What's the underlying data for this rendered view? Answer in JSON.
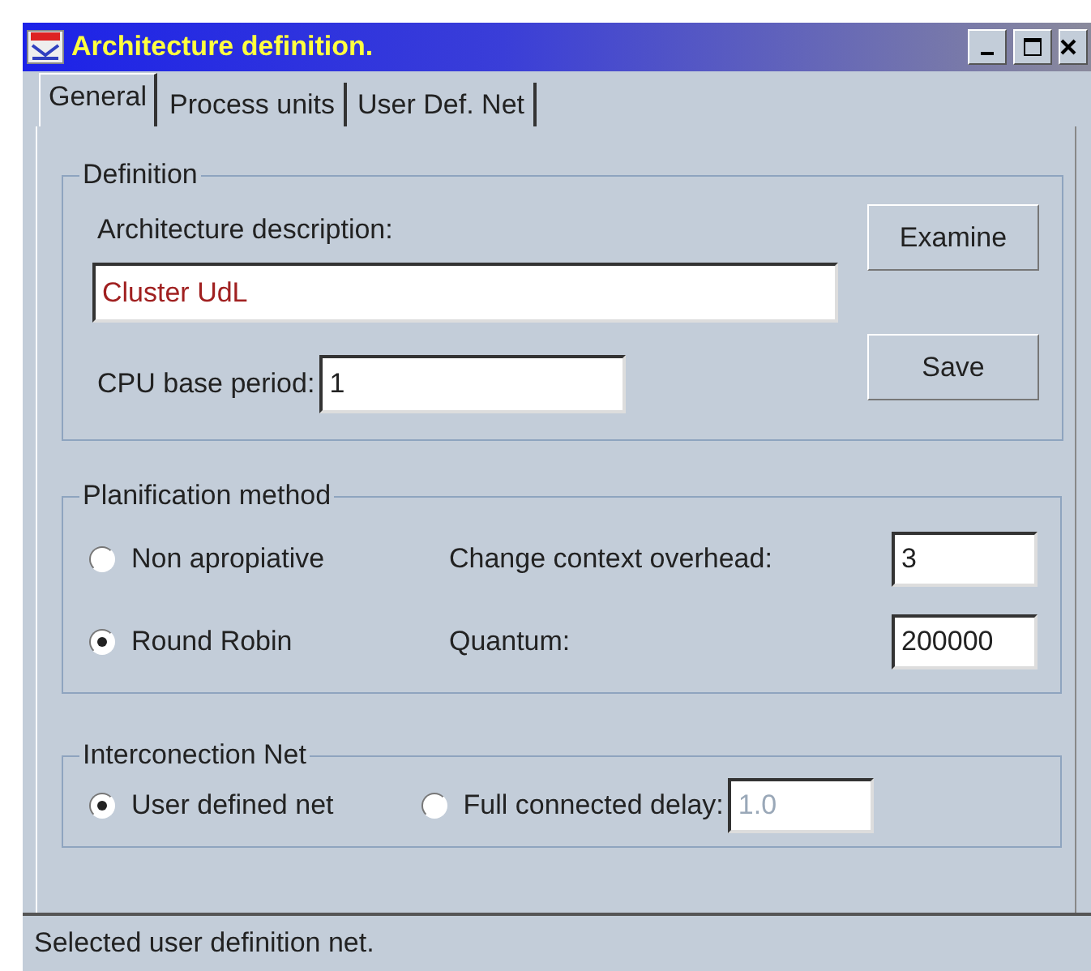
{
  "window": {
    "title": "Architecture definition."
  },
  "tabs": [
    {
      "label": "General",
      "selected": true
    },
    {
      "label": "Process units",
      "selected": false
    },
    {
      "label": "User Def. Net",
      "selected": false
    }
  ],
  "definition": {
    "title": "Definition",
    "description_label": "Architecture description:",
    "description_value": "Cluster UdL",
    "cpu_label": "CPU base period:",
    "cpu_value": "1",
    "buttons": [
      "Examine",
      "Save"
    ]
  },
  "planification": {
    "title": "Planification method",
    "options": [
      {
        "label": "Non apropiative",
        "selected": false
      },
      {
        "label": "Round Robin",
        "selected": true
      }
    ],
    "fields": [
      {
        "label": "Change context overhead:",
        "value": "3"
      },
      {
        "label": "Quantum:",
        "value": "200000"
      }
    ]
  },
  "interconnection": {
    "title": "Interconection Net",
    "options": [
      {
        "label": "User defined net",
        "selected": true
      },
      {
        "label": "Full connected delay:",
        "selected": false
      }
    ],
    "delay_value": "1.0",
    "delay_disabled": true
  },
  "status_bar": "Selected user definition net."
}
